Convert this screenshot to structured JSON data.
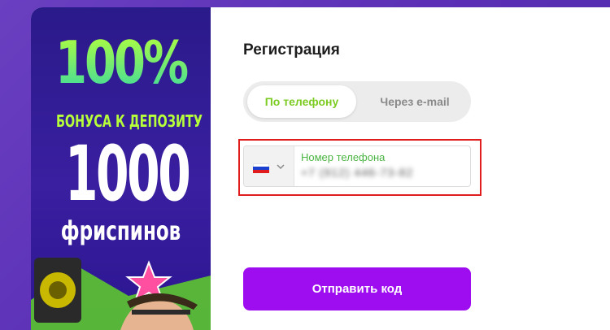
{
  "promo": {
    "headline_percent": "100%",
    "bonus_text": "БОНУСА К ДЕПОЗИТУ",
    "freespins_count": "1000",
    "freespins_label": "фриспинов"
  },
  "form": {
    "title": "Регистрация",
    "tabs": [
      {
        "label": "По телефону",
        "active": true
      },
      {
        "label": "Через e-mail",
        "active": false
      }
    ],
    "phone": {
      "label": "Номер телефона",
      "value": "+7 (912) 446-73-82",
      "country_flag": "russia-flag-icon"
    },
    "submit_label": "Отправить код"
  },
  "colors": {
    "accent_green": "#7ccb22",
    "button_purple": "#9e0cf0",
    "highlight_red": "#e01c1c",
    "background_purple": "#5a2fb5"
  }
}
